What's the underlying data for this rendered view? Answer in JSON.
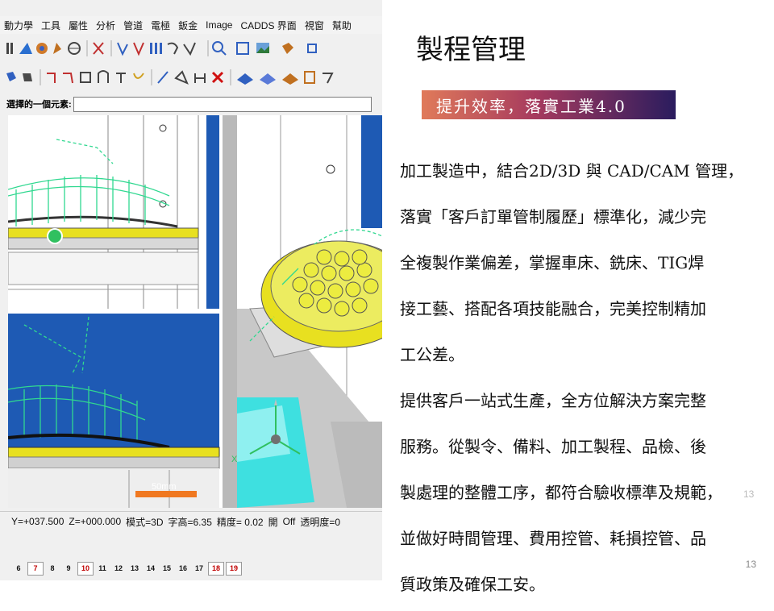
{
  "menu": [
    "動力學",
    "工具",
    "屬性",
    "分析",
    "管道",
    "電極",
    "鈑金",
    "Image",
    "CADDS 界面",
    "視窗",
    "幫助"
  ],
  "prompt": {
    "label": "選擇的一個元素:",
    "value": ""
  },
  "statusbar": [
    "Y=+037.500",
    "Z=+000.000",
    "模式=3D",
    "字高=6.35",
    "精度= 0.02",
    "開",
    "Off",
    "透明度=0"
  ],
  "layers": {
    "items": [
      "6",
      "7",
      "8",
      "9",
      "10",
      "11",
      "12",
      "13",
      "14",
      "15",
      "16",
      "17",
      "18",
      "19"
    ],
    "active": [
      "7",
      "10",
      "18",
      "19"
    ]
  },
  "scale_label": "50mm",
  "axis_label": "X",
  "slide": {
    "title": "製程管理",
    "banner": "提升效率，落實工業4.0",
    "paragraph1": [
      "加工製造中，結合2D/3D 與 CAD/CAM 管理，",
      "落實「客戶訂單管制履歷」標準化，減少完",
      "全複製作業偏差，掌握車床、銑床、TIG焊",
      "接工藝、搭配各項技能融合，完美控制精加",
      "工公差。"
    ],
    "paragraph2": [
      "提供客戶一站式生產，全方位解決方案完整",
      "服務。從製令、備料、加工製程、品檢、後",
      "製處理的整體工序，都符合驗收標準及規範，",
      "並做好時間管理、費用控管、耗損控管、品",
      "質政策及確保工安。"
    ],
    "ghost_number": "13",
    "page_number": "13"
  },
  "colors": {
    "banner_start": "#e07a5a",
    "banner_end": "#2a1c5e",
    "viewport_blue": "#1e5ab4",
    "part_yellow": "#e8e020",
    "fixture_cyan": "#3ee0e0",
    "toolpath_green": "#30d890"
  }
}
